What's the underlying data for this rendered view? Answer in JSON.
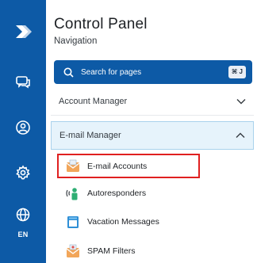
{
  "rail": {
    "items": [
      {
        "icon": "chevron-logo-icon"
      },
      {
        "icon": "chat-icon"
      },
      {
        "icon": "user-circle-icon"
      },
      {
        "icon": "gear-icon"
      },
      {
        "icon": "globe-icon",
        "label": "EN"
      }
    ],
    "color": "#0d5aa6"
  },
  "panel": {
    "title": "Control Panel",
    "subtitle": "Navigation",
    "search": {
      "placeholder": "Search for pages",
      "shortcut": "⌘ J"
    },
    "sections": [
      {
        "label": "Account Manager",
        "expanded": false
      },
      {
        "label": "E-mail Manager",
        "expanded": true
      }
    ],
    "email_items": [
      {
        "label": "E-mail Accounts",
        "icon": "envelope-icon",
        "highlighted": true
      },
      {
        "label": "Autoresponders",
        "icon": "autoresponder-icon"
      },
      {
        "label": "Vacation Messages",
        "icon": "calendar-icon"
      },
      {
        "label": "SPAM Filters",
        "icon": "spam-filter-icon"
      }
    ]
  },
  "colors": {
    "accent": "#0d5aa6",
    "highlight": "#e02020",
    "expanded_bg": "#e6f3fb"
  }
}
